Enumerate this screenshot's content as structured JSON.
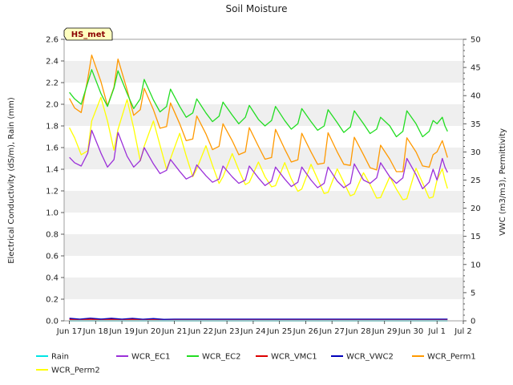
{
  "chart_data": {
    "type": "line",
    "title": "Soil Moisture",
    "ylabel": "Electrical Conductivity (dS/m), Rain (mm)",
    "y2label": "VWC (m3/m3), Permittivity",
    "station_badge": "HS_met",
    "ylim": [
      0.0,
      2.6
    ],
    "y2lim": [
      0,
      50
    ],
    "xlim": [
      16.8,
      32.0
    ],
    "x_tick_values": [
      17,
      18,
      19,
      20,
      21,
      22,
      23,
      24,
      25,
      26,
      27,
      28,
      29,
      30,
      31,
      32
    ],
    "x_tick_labels": [
      "Jun 17",
      "Jun 18",
      "Jun 19",
      "Jun 20",
      "Jun 21",
      "Jun 22",
      "Jun 23",
      "Jun 24",
      "Jun 25",
      "Jun 26",
      "Jun 27",
      "Jun 28",
      "Jun 29",
      "Jun 30",
      "Jul 1",
      "Jul 2"
    ],
    "y_ticks": [
      0.0,
      0.2,
      0.4,
      0.6,
      0.8,
      1.0,
      1.2,
      1.4,
      1.6,
      1.8,
      2.0,
      2.2,
      2.4,
      2.6
    ],
    "y_tick_labels": [
      "0.0",
      "0.2",
      "0.4",
      "0.6",
      "0.8",
      "1.0",
      "1.2",
      "1.4",
      "1.6",
      "1.8",
      "2.0",
      "2.2",
      "2.4",
      "2.6"
    ],
    "y2_ticks": [
      0,
      5,
      10,
      15,
      20,
      25,
      30,
      35,
      40,
      45,
      50
    ],
    "y2_tick_labels": [
      "0",
      "5",
      "10",
      "15",
      "20",
      "25",
      "30",
      "35",
      "40",
      "45",
      "50"
    ],
    "grid": "horizontal bands",
    "legend_placement": "below",
    "series": [
      {
        "name": "Rain",
        "color": "#00e5e5",
        "axis": "left",
        "x": [
          17.0,
          31.4
        ],
        "values": [
          0.0,
          0.0
        ]
      },
      {
        "name": "WCR_Perm2",
        "color": "#ffff00",
        "axis": "right",
        "x": [
          17.0,
          17.2,
          17.45,
          17.7,
          17.85,
          18.2,
          18.45,
          18.7,
          18.85,
          19.2,
          19.45,
          19.7,
          19.85,
          20.2,
          20.45,
          20.7,
          20.85,
          21.2,
          21.45,
          21.7,
          21.85,
          22.2,
          22.45,
          22.7,
          22.85,
          23.2,
          23.45,
          23.7,
          23.85,
          24.2,
          24.45,
          24.7,
          24.85,
          25.2,
          25.45,
          25.7,
          25.85,
          26.2,
          26.45,
          26.7,
          26.85,
          27.2,
          27.45,
          27.7,
          27.85,
          28.2,
          28.45,
          28.7,
          28.85,
          29.2,
          29.45,
          29.7,
          29.85,
          30.2,
          30.45,
          30.7,
          30.85,
          31.0,
          31.2,
          31.3,
          31.4
        ],
        "values": [
          34.3,
          32.5,
          29.5,
          30.2,
          35.5,
          39.7,
          35.5,
          30.3,
          34.0,
          39.3,
          34.2,
          28.4,
          31.0,
          35.5,
          31.2,
          26.9,
          28.8,
          33.3,
          29.3,
          25.6,
          27.0,
          31.1,
          27.6,
          24.4,
          25.6,
          29.7,
          26.8,
          24.2,
          24.6,
          28.2,
          25.6,
          23.8,
          24.0,
          28.1,
          25.2,
          23.0,
          23.4,
          27.8,
          25.2,
          22.6,
          22.8,
          27.0,
          24.6,
          22.2,
          22.5,
          26.3,
          24.2,
          21.8,
          21.9,
          25.6,
          23.4,
          21.5,
          21.7,
          27.1,
          24.5,
          21.8,
          22.0,
          25.0,
          27.0,
          25.0,
          23.5
        ]
      },
      {
        "name": "WCR_EC1",
        "color": "#9b30d9",
        "axis": "left",
        "x": [
          17.0,
          17.2,
          17.45,
          17.7,
          17.85,
          18.2,
          18.45,
          18.7,
          18.85,
          19.2,
          19.45,
          19.7,
          19.85,
          20.2,
          20.45,
          20.7,
          20.85,
          21.2,
          21.45,
          21.7,
          21.85,
          22.2,
          22.45,
          22.7,
          22.85,
          23.2,
          23.45,
          23.7,
          23.85,
          24.2,
          24.45,
          24.7,
          24.85,
          25.2,
          25.45,
          25.7,
          25.85,
          26.2,
          26.45,
          26.7,
          26.85,
          27.2,
          27.45,
          27.7,
          27.85,
          28.2,
          28.45,
          28.7,
          28.85,
          29.2,
          29.45,
          29.7,
          29.85,
          30.2,
          30.45,
          30.7,
          30.85,
          31.0,
          31.2,
          31.3,
          31.4
        ],
        "values": [
          1.51,
          1.46,
          1.43,
          1.55,
          1.76,
          1.55,
          1.42,
          1.49,
          1.74,
          1.52,
          1.42,
          1.48,
          1.6,
          1.45,
          1.36,
          1.39,
          1.49,
          1.38,
          1.31,
          1.34,
          1.44,
          1.34,
          1.28,
          1.31,
          1.43,
          1.33,
          1.27,
          1.3,
          1.43,
          1.32,
          1.25,
          1.29,
          1.42,
          1.31,
          1.24,
          1.28,
          1.42,
          1.3,
          1.23,
          1.27,
          1.42,
          1.29,
          1.23,
          1.27,
          1.45,
          1.3,
          1.27,
          1.32,
          1.46,
          1.33,
          1.27,
          1.32,
          1.5,
          1.35,
          1.22,
          1.28,
          1.4,
          1.3,
          1.5,
          1.42,
          1.37
        ]
      },
      {
        "name": "WCR_EC2",
        "color": "#22dd22",
        "axis": "left",
        "x": [
          17.0,
          17.2,
          17.45,
          17.7,
          17.85,
          18.2,
          18.45,
          18.7,
          18.85,
          19.2,
          19.45,
          19.7,
          19.85,
          20.2,
          20.45,
          20.7,
          20.85,
          21.2,
          21.45,
          21.7,
          21.85,
          22.2,
          22.45,
          22.7,
          22.85,
          23.2,
          23.45,
          23.7,
          23.85,
          24.2,
          24.45,
          24.7,
          24.85,
          25.2,
          25.45,
          25.7,
          25.85,
          26.2,
          26.45,
          26.7,
          26.85,
          27.2,
          27.45,
          27.7,
          27.85,
          28.2,
          28.45,
          28.7,
          28.85,
          29.2,
          29.45,
          29.7,
          29.85,
          30.2,
          30.45,
          30.7,
          30.85,
          31.0,
          31.2,
          31.3,
          31.4
        ],
        "values": [
          2.11,
          2.05,
          2.0,
          2.2,
          2.32,
          2.1,
          1.98,
          2.15,
          2.31,
          2.1,
          1.96,
          2.05,
          2.23,
          2.04,
          1.93,
          1.98,
          2.14,
          1.98,
          1.88,
          1.92,
          2.05,
          1.92,
          1.84,
          1.89,
          2.02,
          1.9,
          1.82,
          1.88,
          1.99,
          1.86,
          1.8,
          1.85,
          1.98,
          1.85,
          1.77,
          1.82,
          1.96,
          1.84,
          1.76,
          1.8,
          1.95,
          1.83,
          1.74,
          1.79,
          1.94,
          1.82,
          1.73,
          1.77,
          1.88,
          1.8,
          1.7,
          1.75,
          1.94,
          1.82,
          1.7,
          1.75,
          1.85,
          1.82,
          1.88,
          1.8,
          1.75
        ]
      },
      {
        "name": "WCR_VMC1",
        "color": "#dd0000",
        "axis": "right",
        "x": [
          17.0,
          31.4
        ],
        "values": [
          0.25,
          0.25
        ]
      },
      {
        "name": "WCR_VWC2",
        "color": "#0000bb",
        "axis": "right",
        "x": [
          17.0,
          17.4,
          17.8,
          18.2,
          18.6,
          19.0,
          19.4,
          19.8,
          20.2,
          20.6,
          21.0,
          31.4
        ],
        "values": [
          0.45,
          0.3,
          0.48,
          0.32,
          0.46,
          0.3,
          0.44,
          0.28,
          0.4,
          0.26,
          0.3,
          0.3
        ]
      },
      {
        "name": "WCR_Perm1",
        "color": "#ff9900",
        "axis": "right",
        "x": [
          17.0,
          17.2,
          17.45,
          17.7,
          17.85,
          18.2,
          18.45,
          18.7,
          18.85,
          19.2,
          19.45,
          19.7,
          19.85,
          20.2,
          20.45,
          20.7,
          20.85,
          21.2,
          21.45,
          21.7,
          21.85,
          22.2,
          22.45,
          22.7,
          22.85,
          23.2,
          23.45,
          23.7,
          23.85,
          24.2,
          24.45,
          24.7,
          24.85,
          25.2,
          25.45,
          25.7,
          25.85,
          26.2,
          26.45,
          26.7,
          26.85,
          27.2,
          27.45,
          27.7,
          27.85,
          28.2,
          28.45,
          28.7,
          28.85,
          29.2,
          29.45,
          29.7,
          29.85,
          30.2,
          30.45,
          30.7,
          30.85,
          31.0,
          31.2,
          31.3,
          31.4
        ],
        "values": [
          39.5,
          37.8,
          37.0,
          43.0,
          47.2,
          42.5,
          38.2,
          41.5,
          46.5,
          41.0,
          36.5,
          37.5,
          41.3,
          37.5,
          34.2,
          34.5,
          38.7,
          35.0,
          32.0,
          32.3,
          36.4,
          33.2,
          30.4,
          31.0,
          35.0,
          32.0,
          29.5,
          30.0,
          34.3,
          31.0,
          28.7,
          29.0,
          34.0,
          30.5,
          28.2,
          28.6,
          33.3,
          30.0,
          27.8,
          28.0,
          33.4,
          30.0,
          27.8,
          27.6,
          32.6,
          29.5,
          27.2,
          26.8,
          31.2,
          28.7,
          26.5,
          26.5,
          32.5,
          30.0,
          27.5,
          27.3,
          29.5,
          30.0,
          32.0,
          30.5,
          29.0
        ]
      }
    ]
  }
}
